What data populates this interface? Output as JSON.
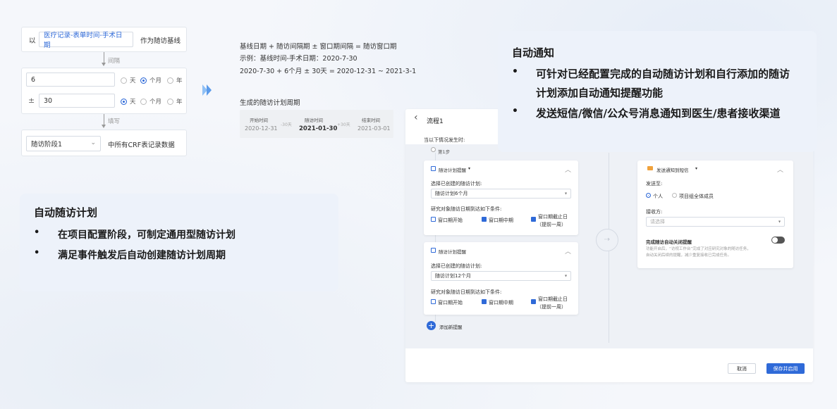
{
  "baseline": {
    "prefix": "以",
    "field_value": "医疗记录-表单时间-手术日期",
    "suffix": "作为随访基线"
  },
  "interval": {
    "label": "间隔",
    "value": "6",
    "units": [
      "天",
      "个月",
      "年"
    ],
    "selected_unit": "个月"
  },
  "window": {
    "sign": "±",
    "value": "30",
    "units": [
      "天",
      "个月",
      "年"
    ],
    "selected_unit": "天"
  },
  "fill": {
    "label": "填写",
    "stage_value": "随访阶段1",
    "suffix": "中所有CRF表记录数据"
  },
  "formula": {
    "line1": "基线日期 + 随访间隔期 ± 窗口期间隔 = 随访窗口期",
    "line2": "示例：基线时间-手术日期：2020-7-30",
    "line3": "2020-7-30 + 6个月 ± 30天  =  2020-12-31 ~ 2021-3-1"
  },
  "generated": {
    "title": "生成的随访计划周期",
    "start_label": "开始时间",
    "start_date": "2020-12-31",
    "minus_label": "-30天",
    "visit_label": "随访时间",
    "visit_date": "2021-01-30",
    "plus_label": "+30天",
    "end_label": "结束时间",
    "end_date": "2021-03-01"
  },
  "card_auto_plan": {
    "title": "自动随访计划",
    "bullets": [
      "在项目配置阶段，可制定通用型随访计划",
      "满足事件触发后自动创建随访计划周期"
    ]
  },
  "card_auto_notify": {
    "title": "自动通知",
    "bullets": [
      "可针对已经配置完成的自动随访计划和自行添加的随访计划添加自动通知提醒功能",
      "发送短信/微信/公众号消息通知到医生/患者接收渠道"
    ]
  },
  "process": {
    "back_glyph": "‹",
    "title": "流程1",
    "trigger_label": "当以下情况发生时:",
    "step_label": "第1步",
    "reminder1": {
      "title": "随访计划提醒",
      "select_label": "选择已创建的随访计划:",
      "select_value": "随访计划6个月",
      "cond_label": "研究对象随访日期到达如下条件:",
      "opt1": "窗口期开始",
      "opt2": "窗口期中期",
      "opt3a": "窗口期截止日",
      "opt3b": "（提前一周）"
    },
    "reminder2": {
      "title": "随访计划提醒",
      "select_label": "选择已创建的随访计划:",
      "select_value": "随访计划12个月",
      "cond_label": "研究对象随访日期到达如下条件:",
      "opt1": "窗口期开始",
      "opt2": "窗口期中期",
      "opt3a": "窗口期截止日",
      "opt3b": "（提前一周）"
    },
    "add_label": "添加新提醒",
    "send": {
      "title": "发送通知到短信",
      "send_to_label": "发送至:",
      "opt_person": "个人",
      "opt_group": "项目组全体成员",
      "receiver_label": "接收方:",
      "receiver_placeholder": "请选择",
      "auto_close_title": "完成随访自动关闭提醒",
      "auto_close_desc1": "功能开启后，“访视工作台”完成了对应研究对象的随访任务，",
      "auto_close_desc2": "自动关闭后续的提醒，减少重复接收已完成任务。"
    },
    "cancel_label": "取消",
    "save_label": "保存并启用"
  },
  "colors": {
    "accent": "#2f6ad8",
    "card_bg": "#edf2fa",
    "arrow": "#5b9bea"
  }
}
